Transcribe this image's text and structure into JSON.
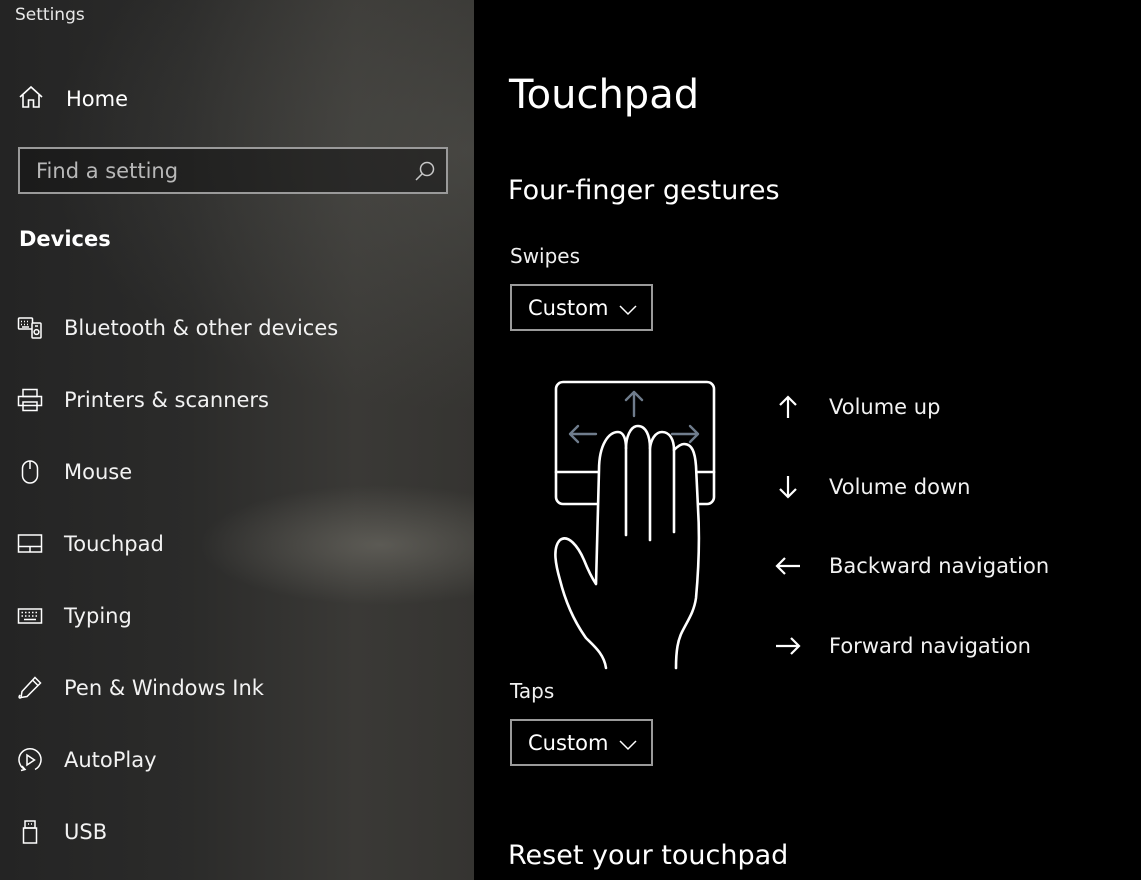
{
  "app": {
    "title": "Settings"
  },
  "sidebar": {
    "home_label": "Home",
    "search_placeholder": "Find a setting",
    "section_title": "Devices",
    "items": [
      {
        "label": "Bluetooth & other devices",
        "icon": "bluetooth-devices-icon"
      },
      {
        "label": "Printers & scanners",
        "icon": "printer-icon"
      },
      {
        "label": "Mouse",
        "icon": "mouse-icon"
      },
      {
        "label": "Touchpad",
        "icon": "touchpad-icon"
      },
      {
        "label": "Typing",
        "icon": "keyboard-icon"
      },
      {
        "label": "Pen & Windows Ink",
        "icon": "pen-icon"
      },
      {
        "label": "AutoPlay",
        "icon": "autoplay-icon"
      },
      {
        "label": "USB",
        "icon": "usb-icon"
      }
    ]
  },
  "main": {
    "title": "Touchpad",
    "four_finger_heading": "Four-finger gestures",
    "swipes_label": "Swipes",
    "swipes_value": "Custom",
    "gestures": [
      {
        "direction": "up",
        "label": "Volume up"
      },
      {
        "direction": "down",
        "label": "Volume down"
      },
      {
        "direction": "left",
        "label": "Backward navigation"
      },
      {
        "direction": "right",
        "label": "Forward navigation"
      }
    ],
    "taps_label": "Taps",
    "taps_value": "Custom",
    "reset_heading": "Reset your touchpad"
  }
}
